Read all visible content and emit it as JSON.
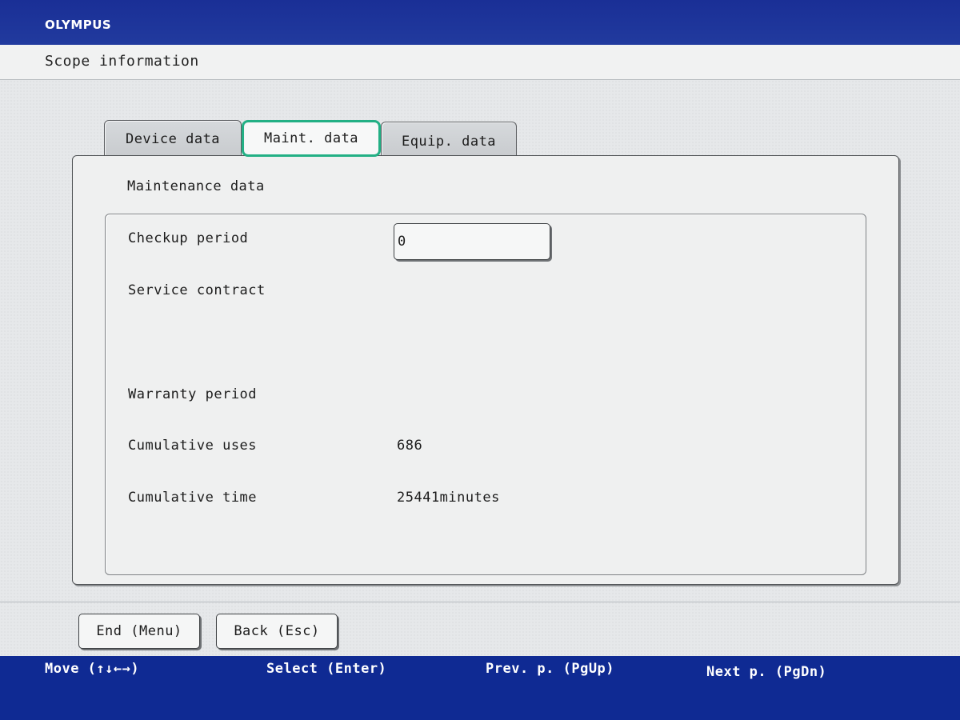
{
  "header": {
    "brand": "OLYMPUS"
  },
  "title_bar": {
    "title": "Scope information"
  },
  "tabs": [
    {
      "label": "Device data",
      "active": false
    },
    {
      "label": "Maint. data",
      "active": true
    },
    {
      "label": "Equip. data",
      "active": false
    }
  ],
  "panel": {
    "heading": "Maintenance data",
    "fields": {
      "checkup_period": {
        "label": "Checkup period",
        "value": "0"
      },
      "service_contract": {
        "label": "Service contract",
        "value": ""
      },
      "warranty_period": {
        "label": "Warranty period",
        "value": ""
      },
      "cumulative_uses": {
        "label": "Cumulative uses",
        "value": "686"
      },
      "cumulative_time": {
        "label": "Cumulative time",
        "value": "25441minutes"
      }
    }
  },
  "buttons": {
    "end": "End (Menu)",
    "back": "Back (Esc)"
  },
  "footer_hints": {
    "move": "Move (↑↓←→)",
    "select": "Select (Enter)",
    "prev": "Prev. p. (PgUp)",
    "next": "Next p. (PgDn)"
  },
  "colors": {
    "frame_blue": "#0f2a93",
    "active_tab_outline": "#23b085",
    "screen_background": "#e6e8ea"
  }
}
